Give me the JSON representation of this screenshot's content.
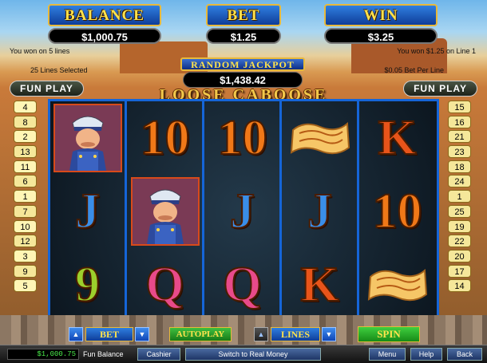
{
  "meters": {
    "balance": {
      "label": "BALANCE",
      "value": "$1,000.75"
    },
    "bet": {
      "label": "BET",
      "value": "$1.25"
    },
    "win": {
      "label": "WIN",
      "value": "$3.25"
    }
  },
  "info": {
    "won_lines": "You won on 5 lines",
    "lines_selected": "25 Lines Selected",
    "won_on_line": "You won $1.25 on Line 1",
    "bet_per_line": "$0.05 Bet Per Line"
  },
  "jackpot": {
    "label": "RANDOM JACKPOT",
    "value": "$1,438.42"
  },
  "logo": "LOOSE CABOOSE",
  "fun_play_left": "FUN PLAY",
  "fun_play_right": "FUN PLAY",
  "left_lines": [
    "4",
    "8",
    "2",
    "13",
    "11",
    "6",
    "1",
    "7",
    "10",
    "12",
    "3",
    "9",
    "5"
  ],
  "right_lines": [
    "15",
    "16",
    "21",
    "23",
    "18",
    "24",
    "1",
    "25",
    "19",
    "22",
    "20",
    "17",
    "14"
  ],
  "reels": [
    [
      "conductor",
      "J",
      "9"
    ],
    [
      "10",
      "conductor",
      "Q"
    ],
    [
      "10",
      "J",
      "Q"
    ],
    [
      "ticket",
      "J",
      "K"
    ],
    [
      "K",
      "10",
      "ticket"
    ]
  ],
  "controls": {
    "bet_label": "BET",
    "autoplay_label": "AUTOPLAY",
    "lines_label": "LINES",
    "spin_label": "SPIN",
    "up_arrow": "▲",
    "down_arrow": "▼"
  },
  "statusbar": {
    "balance": "$1,000.75",
    "mode": "Fun Balance",
    "cashier": "Cashier",
    "switch": "Switch to Real Money",
    "menu": "Menu",
    "help": "Help",
    "back": "Back"
  },
  "colors": {
    "accent_blue": "#1565d8",
    "gold": "#e8b93a",
    "spin_green": "#2aa82a"
  }
}
